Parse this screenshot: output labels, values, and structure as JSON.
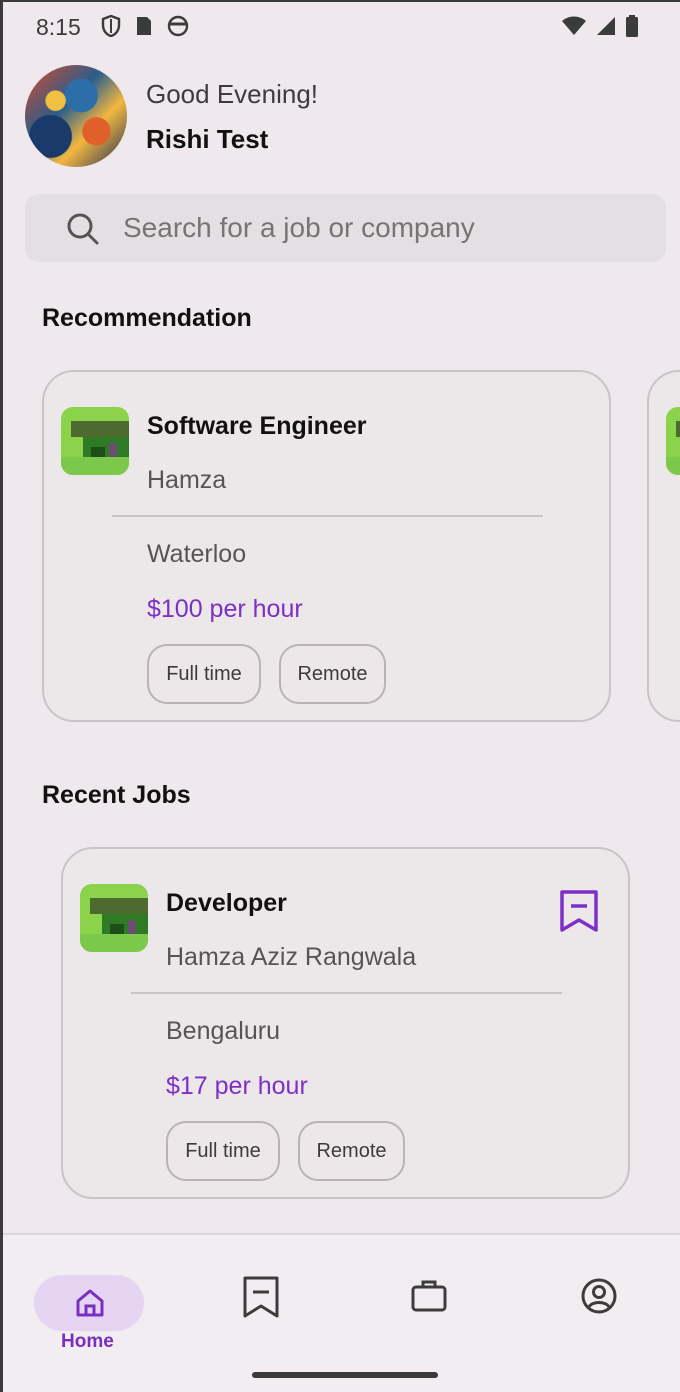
{
  "status_bar": {
    "time": "8:15",
    "left_icons": [
      "shield-icon",
      "sim-card-icon",
      "face-icon"
    ],
    "right_icons": [
      "wifi-icon",
      "signal-icon",
      "battery-icon"
    ]
  },
  "header": {
    "greeting": "Good Evening!",
    "user_name": "Rishi Test"
  },
  "search": {
    "placeholder": "Search for a job or company"
  },
  "recommendation": {
    "title": "Recommendation",
    "cards": [
      {
        "title": "Software Engineer",
        "company": "Hamza",
        "location": "Waterloo",
        "salary": "$100 per hour",
        "tags": [
          "Full time",
          "Remote"
        ]
      }
    ]
  },
  "recent_jobs": {
    "title": "Recent Jobs",
    "items": [
      {
        "title": "Developer",
        "company": "Hamza Aziz Rangwala",
        "location": "Bengaluru",
        "salary": "$17 per hour",
        "tags": [
          "Full time",
          "Remote"
        ]
      }
    ]
  },
  "bottom_nav": {
    "items": [
      {
        "label": "Home",
        "icon": "home-icon",
        "active": true
      },
      {
        "label": "",
        "icon": "bookmark-icon",
        "active": false
      },
      {
        "label": "",
        "icon": "briefcase-icon",
        "active": false
      },
      {
        "label": "",
        "icon": "profile-icon",
        "active": false
      }
    ]
  },
  "colors": {
    "accent": "#7d2fc6",
    "background": "#efe8ec",
    "active_pill": "#e6d4f3"
  }
}
